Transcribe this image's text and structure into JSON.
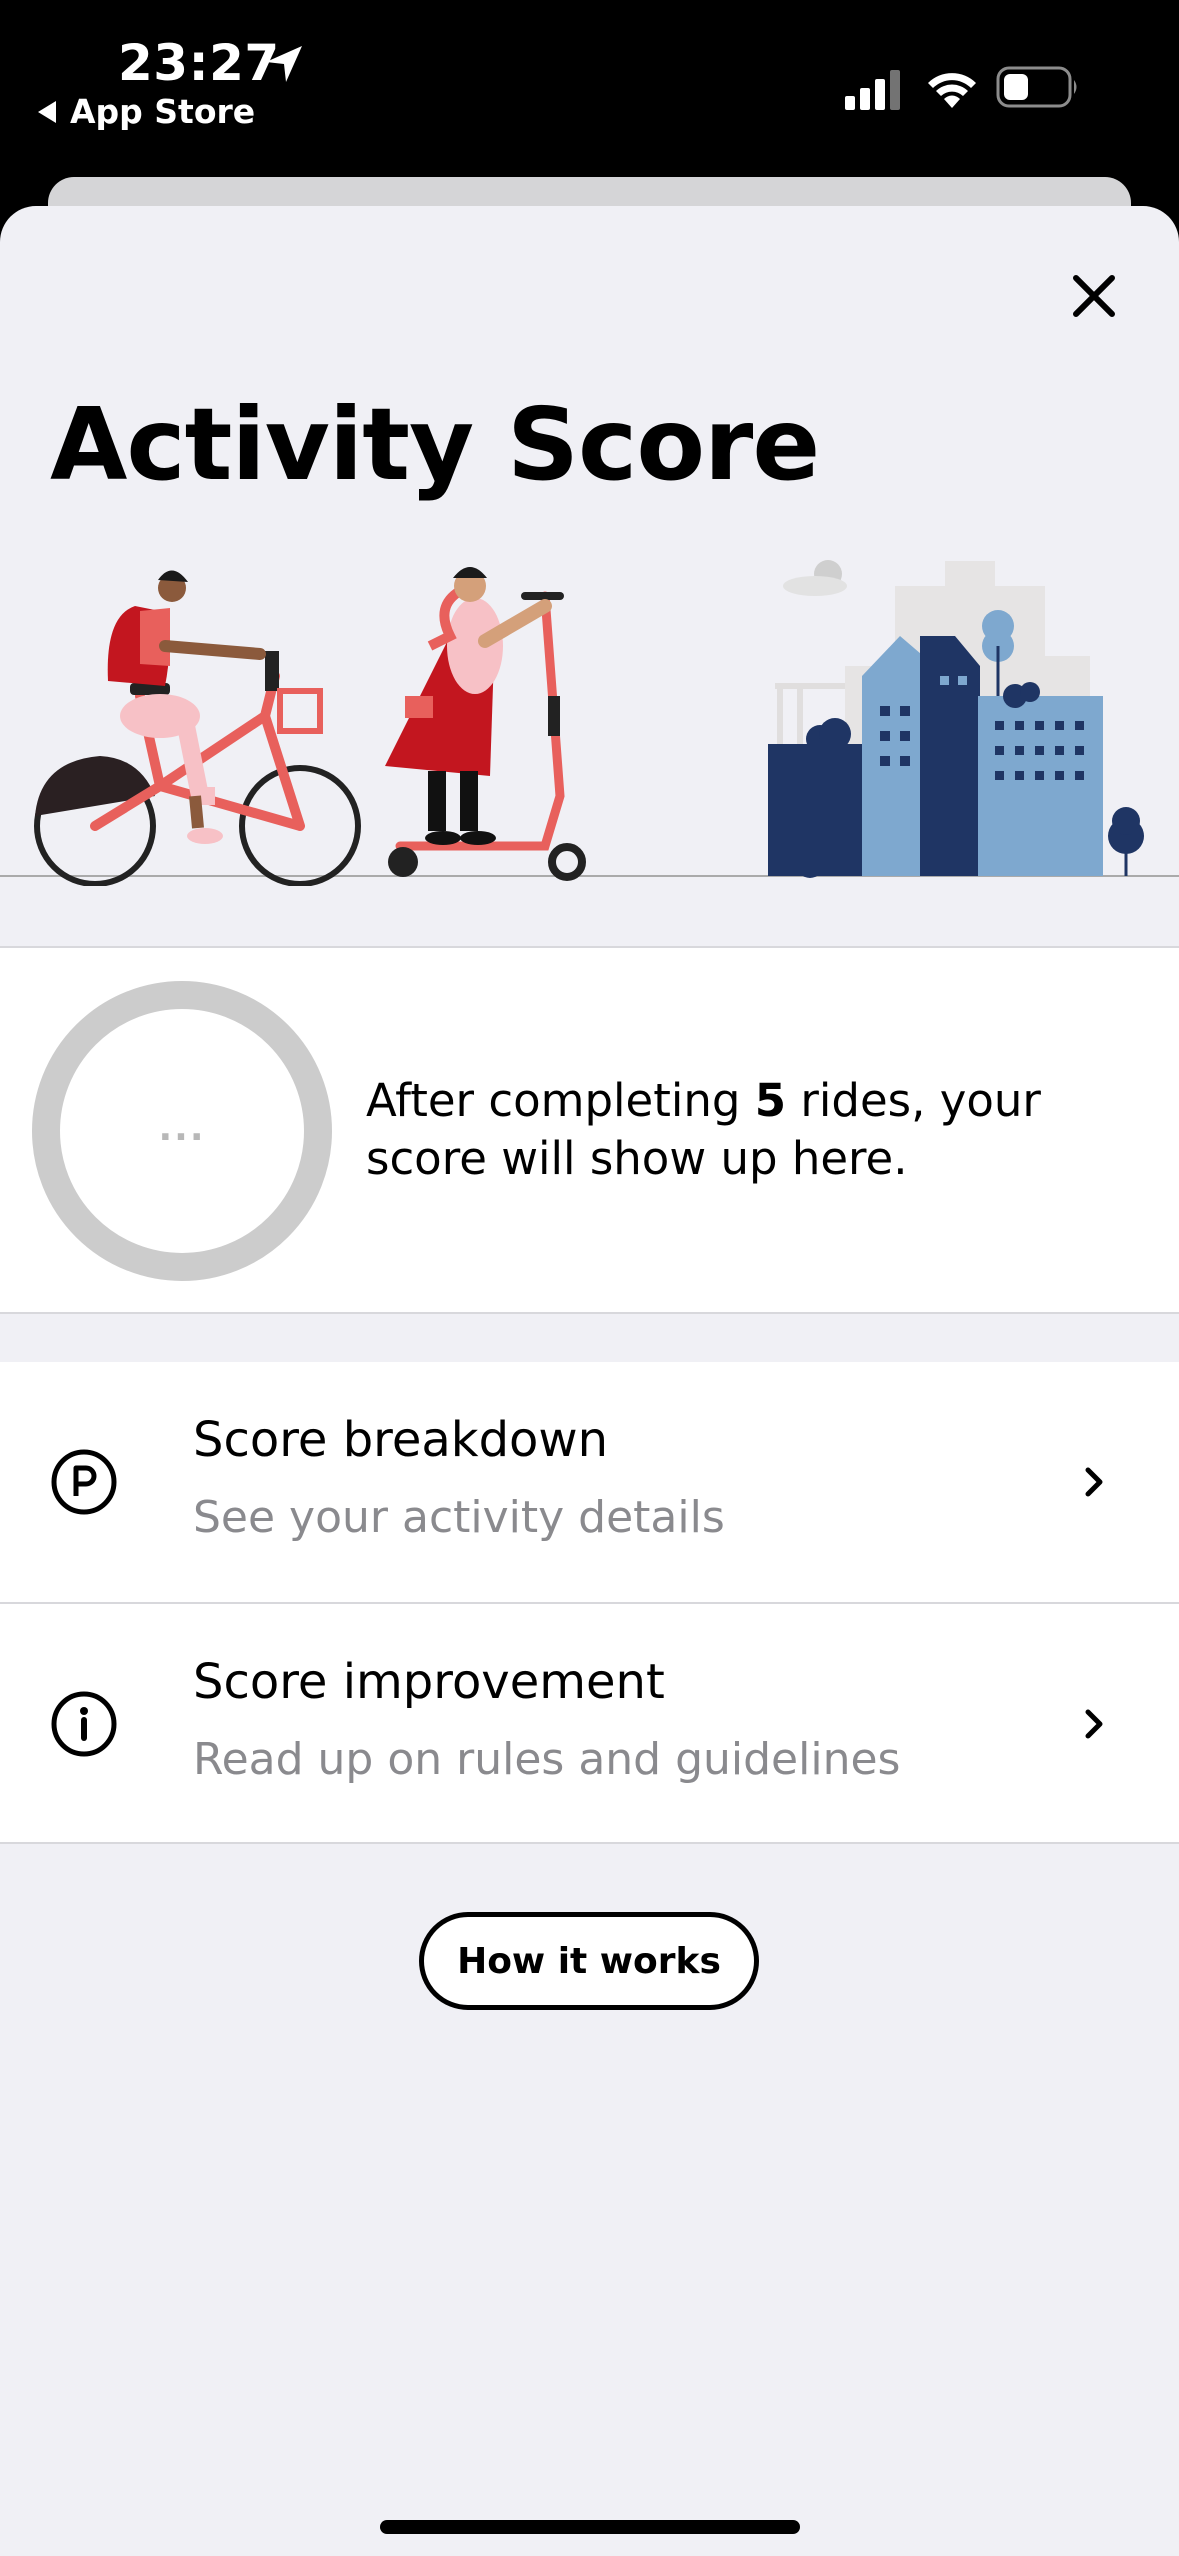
{
  "status_bar": {
    "time": "23:27",
    "back_label": "App Store"
  },
  "page": {
    "title": "Activity Score"
  },
  "score": {
    "placeholder": "...",
    "message_prefix": "After completing ",
    "rides_count": "5",
    "message_suffix": " rides, your score will show up here."
  },
  "menu": {
    "items": [
      {
        "title": "Score breakdown",
        "subtitle": "See your activity details",
        "icon": "parking-icon"
      },
      {
        "title": "Score improvement",
        "subtitle": "Read up on rules and guidelines",
        "icon": "info-icon"
      }
    ]
  },
  "actions": {
    "how_it_works": "How it works"
  },
  "colors": {
    "sheet_bg": "#f0f0f5",
    "accent_red": "#e8605c",
    "city_blue": "#7ea8cf",
    "city_navy": "#1f3564"
  }
}
